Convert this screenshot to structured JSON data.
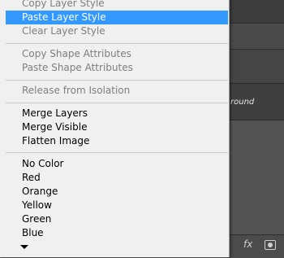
{
  "menu": {
    "items": [
      {
        "label": "Copy Layer Style",
        "state": "disabled"
      },
      {
        "label": "Paste Layer Style",
        "state": "highlighted"
      },
      {
        "label": "Clear Layer Style",
        "state": "disabled"
      },
      {
        "label": "Copy Shape Attributes",
        "state": "disabled"
      },
      {
        "label": "Paste Shape Attributes",
        "state": "disabled"
      },
      {
        "label": "Release from Isolation",
        "state": "disabled"
      },
      {
        "label": "Merge Layers",
        "state": "enabled"
      },
      {
        "label": "Merge Visible",
        "state": "enabled"
      },
      {
        "label": "Flatten Image",
        "state": "enabled"
      },
      {
        "label": "No Color",
        "state": "enabled"
      },
      {
        "label": "Red",
        "state": "enabled"
      },
      {
        "label": "Orange",
        "state": "enabled"
      },
      {
        "label": "Yellow",
        "state": "enabled"
      },
      {
        "label": "Green",
        "state": "enabled"
      },
      {
        "label": "Blue",
        "state": "enabled"
      }
    ],
    "more_icon": "chevron-down-icon"
  },
  "background": {
    "layer_label": "round",
    "fx_label": "fx",
    "mask_icon": "layer-mask-icon"
  },
  "colors": {
    "menu_bg": "#f0f0f0",
    "highlight": "#3399ff",
    "disabled_text": "#7e7e7e",
    "panel_bg": "#535353"
  }
}
